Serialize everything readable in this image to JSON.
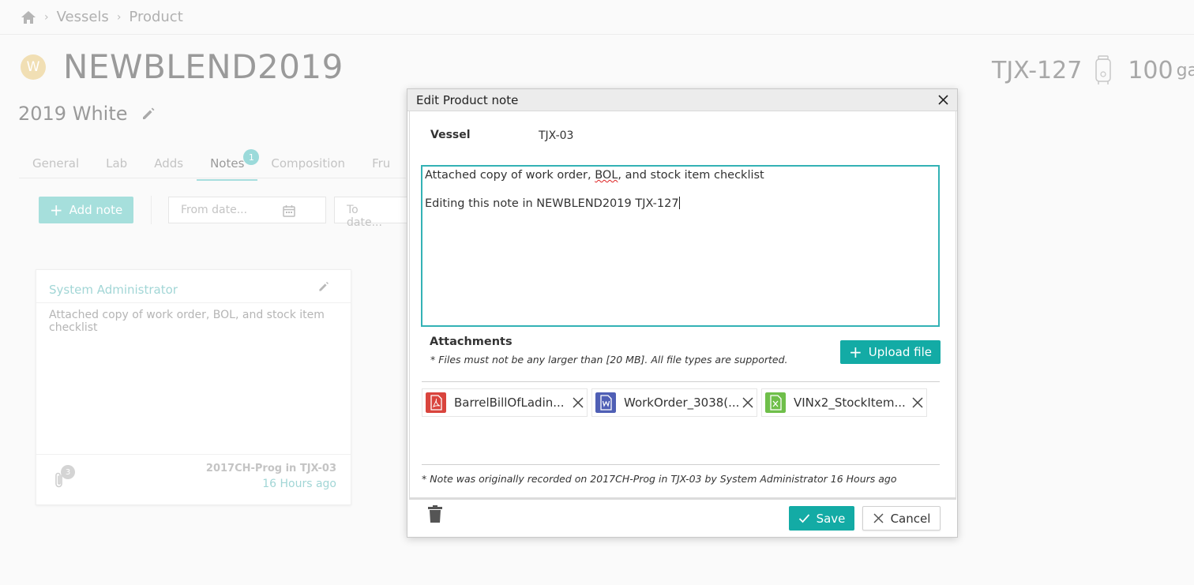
{
  "breadcrumb": {
    "items": [
      "Vessels",
      "Product"
    ]
  },
  "product": {
    "badge": "W",
    "title": "NEWBLEND2019",
    "subtitle": "2019 White",
    "vessel_code": "TJX-127",
    "volume": "100",
    "volume_unit": "gal"
  },
  "tabs": [
    {
      "label": "General"
    },
    {
      "label": "Lab"
    },
    {
      "label": "Adds"
    },
    {
      "label": "Notes",
      "count": "1",
      "active": true
    },
    {
      "label": "Composition"
    },
    {
      "label": "Fru"
    }
  ],
  "toolbar": {
    "add_note_label": "Add note",
    "from_date_placeholder": "From date...",
    "to_date_placeholder": "To date..."
  },
  "note_card": {
    "author": "System Administrator",
    "body": "Attached copy of work order, BOL, and stock item checklist",
    "attachment_count": "3",
    "source": "2017CH-Prog in TJX-03",
    "time": "16 Hours ago"
  },
  "modal": {
    "title": "Edit Product note",
    "vessel_label": "Vessel",
    "vessel_value": "TJX-03",
    "note_line1_a": "Attached copy of work order,  ",
    "note_line1_b": "BOL",
    "note_line1_c": ", and stock item checklist",
    "note_line2": "Editing this note in NEWBLEND2019 TJX-127",
    "attachments_title": "Attachments",
    "attachments_hint": "* Files must not be any larger than [20 MB]. All file types are supported.",
    "upload_label": "Upload file",
    "files": [
      {
        "name": "BarrelBillOfLadin...",
        "type": "pdf",
        "color": "#d9443d"
      },
      {
        "name": "WorkOrder_3038(...",
        "type": "word",
        "color": "#4f5fb5"
      },
      {
        "name": "VINx2_StockItem...",
        "type": "excel",
        "color": "#6fbf4a"
      }
    ],
    "original_note": "* Note was originally recorded on 2017CH-Prog in TJX-03 by System Administrator 16 Hours ago",
    "save_label": "Save",
    "cancel_label": "Cancel"
  },
  "colors": {
    "accent": "#13aba5",
    "textarea_border": "#33b2b5",
    "dimmed_accent": "#a6dfdc"
  }
}
